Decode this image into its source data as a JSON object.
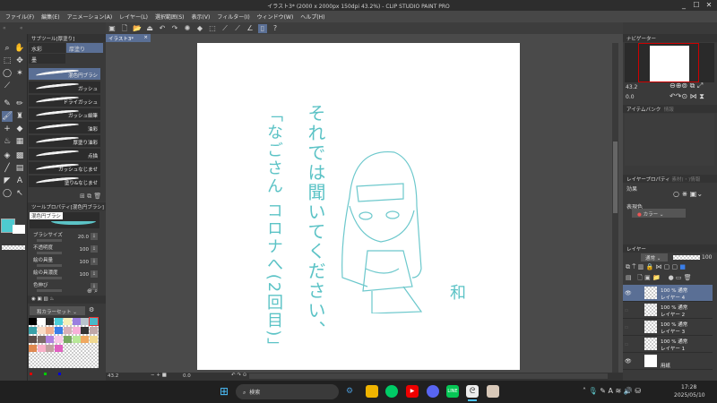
{
  "window": {
    "title": "イラスト3* (2000 x 2000px 150dpi 43.2%) - CLIP STUDIO PAINT PRO",
    "minimize": "_",
    "maximize": "☐",
    "close": "✕"
  },
  "menu": [
    "ファイル(F)",
    "編集(E)",
    "アニメーション(A)",
    "レイヤー(L)",
    "選択範囲(S)",
    "表示(V)",
    "フィルター(I)",
    "ウィンドウ(W)",
    "ヘルプ(H)"
  ],
  "document_tab": {
    "label": "イラスト3*",
    "close": "×"
  },
  "subtool": {
    "title": "サブツール[厚塗り]",
    "groups": [
      "水彩",
      "厚塗り",
      "墨"
    ],
    "selected_group": "厚塗り",
    "brushes": [
      "混色円ブラシ",
      "ガッシュ",
      "ドライガッシュ",
      "ガッシュ細筆",
      "油彩",
      "厚塗り油彩",
      "点描",
      "ガッシュなじませ",
      "塗り&なじませ"
    ],
    "selected_brush": "混色円ブラシ"
  },
  "tool_property": {
    "title": "ツールプロパティ[混色円ブラシ]",
    "preview_label": "混色円ブラシ",
    "props": [
      {
        "label": "ブラシサイズ",
        "value": "20.0"
      },
      {
        "label": "不透明度",
        "value": "100"
      },
      {
        "label": "絵の具量",
        "value": "100"
      },
      {
        "label": "絵の具濃度",
        "value": "100"
      },
      {
        "label": "色伸び",
        "value": ""
      }
    ]
  },
  "color_set": {
    "name": "和カラーセット",
    "swatches": [
      "#000000",
      "#ffffff",
      "#2a2a2a",
      "#4ccfd9",
      "#f5f0b8",
      "#9b7fe0",
      "#b8c4cc",
      "#4ab8c8",
      "#3aa0a8",
      "#f8dcc8",
      "#f0b090",
      "#3a7ee8",
      "#d8b0b8",
      "#f8b0d8",
      "#333333",
      "#c0a8a8",
      "#5a4a48",
      "#7a6a68",
      "#b080e0",
      "#f8c8e8",
      "#78a860",
      "#b8e898",
      "#f0a860",
      "#f0d890",
      "#e08850",
      "#f8b0c8",
      "#c0a0a0",
      "#e060c0"
    ]
  },
  "colors": {
    "main": "#4ecad0",
    "sub": "#ffffff",
    "accent": "#5a6f95",
    "ink": "#5cc3c6"
  },
  "navigator": {
    "title": "ナビゲーター",
    "zoom": "43.2",
    "rotation": "0.0"
  },
  "item_bank": {
    "title": "アイテムバンク",
    "tab2": "情報"
  },
  "layer_property": {
    "title": "レイヤープロパティ",
    "tab2": "素材(・)情報",
    "effect_label": "効果",
    "expression_label": "表現色",
    "expression_value": "カラー"
  },
  "layers_panel": {
    "title": "レイヤー",
    "blend_mode": "通常",
    "opacity": "100",
    "layers": [
      {
        "mode": "100 % 通常",
        "name": "レイヤー 4",
        "visible": true,
        "selected": true
      },
      {
        "mode": "100 % 通常",
        "name": "レイヤー 2",
        "visible": false
      },
      {
        "mode": "100 % 通常",
        "name": "レイヤー 3",
        "visible": false
      },
      {
        "mode": "100 % 通常",
        "name": "レイヤー 1",
        "visible": false
      },
      {
        "mode": "",
        "name": "用紙",
        "visible": true
      }
    ]
  },
  "status": {
    "zoom": "43.2",
    "rotation": "0.0"
  },
  "artwork": {
    "line1": "それでは聞いてください、",
    "line2": "「なごさん コロナへ(2回目)」",
    "signature": "和"
  },
  "taskbar": {
    "search_placeholder": "検索",
    "time": "17:28",
    "date": "2025/05/10",
    "ime": "A"
  }
}
